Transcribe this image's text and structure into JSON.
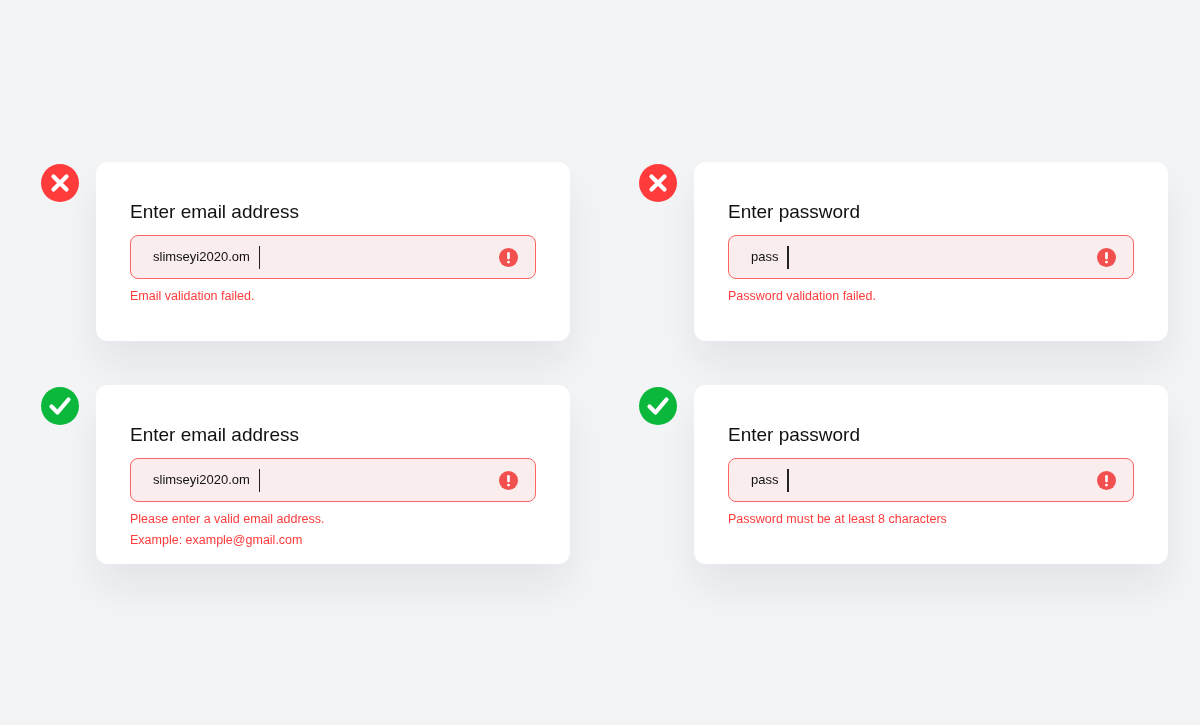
{
  "panels": [
    {
      "kind": "error",
      "label": "Enter email address",
      "field": {
        "value": "slimseyi2020.om",
        "invalid": true,
        "focused": true
      },
      "message_lines": [
        "Email validation failed."
      ]
    },
    {
      "kind": "error",
      "label": "Enter password",
      "field": {
        "value": "pass",
        "invalid": true,
        "focused": true
      },
      "message_lines": [
        "Password validation failed."
      ]
    },
    {
      "kind": "success",
      "label": "Enter email address",
      "field": {
        "value": "slimseyi2020.om",
        "invalid": true,
        "focused": true
      },
      "message_lines": [
        "Please enter a valid email address.",
        "Example: example@gmail.com"
      ]
    },
    {
      "kind": "success",
      "label": "Enter password",
      "field": {
        "value": "pass",
        "invalid": true,
        "focused": true
      },
      "message_lines": [
        "Password must be at least 8 characters"
      ]
    }
  ]
}
